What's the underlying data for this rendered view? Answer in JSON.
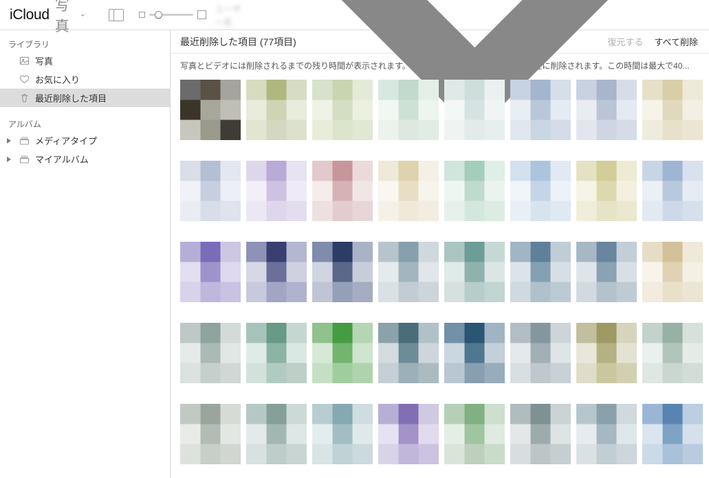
{
  "toolbar": {
    "brand": "iCloud",
    "brand_sub": "写真",
    "account_name": "ユーザー名"
  },
  "sidebar": {
    "section_library": "ライブラリ",
    "items_library": [
      {
        "label": "写真",
        "icon": "photos"
      },
      {
        "label": "お気に入り",
        "icon": "heart"
      },
      {
        "label": "最近削除した項目",
        "icon": "trash",
        "selected": true
      }
    ],
    "section_albums": "アルバム",
    "items_albums": [
      {
        "label": "メディアタイプ",
        "icon": "stack",
        "disclosure": true
      },
      {
        "label": "マイアルバム",
        "icon": "stack",
        "disclosure": true
      }
    ]
  },
  "main": {
    "title": "最近削除した項目 (77項目)",
    "btn_recover": "復元する",
    "btn_delete_all": "すべて削除",
    "info": "写真とビデオには削除されるまでの残り時間が表示されます。この時間が経過すると、項目は完全に削除されます。この時間は最大で40..."
  },
  "grid": {
    "tiles": [
      [
        "6b6b6b",
        "5a5244",
        "a5a49d",
        "3b3529",
        "a7a79b",
        "bfbfb5",
        "c7c7bd",
        "9b9a8c",
        "3e3c35"
      ],
      [
        "d8dcbf",
        "b0b87f",
        "d7dcc5",
        "e9ebdb",
        "cfd4b2",
        "e8ecdd",
        "e2e5d0",
        "d5d8c1",
        "dde1cb"
      ],
      [
        "d7e1cc",
        "c7d6b0",
        "e3ead7",
        "eff3e6",
        "d3dec2",
        "ebf0e0",
        "e8eddb",
        "dce4cb",
        "e0e7d3"
      ],
      [
        "d7e8e0",
        "c1dacd",
        "e4efe8",
        "f1f7f2",
        "cee1d5",
        "eef5ef",
        "ecf2ec",
        "dde9e0",
        "e1ece4"
      ],
      [
        "dfeae8",
        "cddedb",
        "eaf1f0",
        "f3f8f7",
        "d5e4e2",
        "f0f5f4",
        "eff3f2",
        "e2ebea",
        "e6eeee"
      ],
      [
        "c7d3e2",
        "a3b6cd",
        "d6dee9",
        "e9eef4",
        "b8c7d9",
        "e4ebf2",
        "e0e7ef",
        "cbd6e4",
        "d3dce8"
      ],
      [
        "c9d2e1",
        "a8b5cb",
        "d7dde8",
        "e9edf3",
        "bac5d6",
        "e5e9f1",
        "e2e7ef",
        "ced6e3",
        "d5dce7"
      ],
      [
        "e6e0c9",
        "d8cfa7",
        "eee9d8",
        "f6f3e9",
        "e1d9bd",
        "f3efe3",
        "f0ecdd",
        "e7e1cc",
        "ebe5d2"
      ],
      [
        "d9dee9",
        "b5bfd4",
        "e3e7ef",
        "f0f2f7",
        "c7cfdf",
        "eceff5",
        "e9ecf3",
        "d7dde9",
        "dee3ed"
      ],
      [
        "ded7ec",
        "b9aad7",
        "e8e3f2",
        "f2eff8",
        "cec2e2",
        "efebf6",
        "ece7f4",
        "ded6eb",
        "e4ddf0"
      ],
      [
        "e2c9cb",
        "c7969a",
        "ecdadb",
        "f5ecec",
        "d7b2b5",
        "f1e6e6",
        "eee0e1",
        "e3cccf",
        "e8d5d7"
      ],
      [
        "eee9d8",
        "ded2af",
        "f4f0e5",
        "faf7f0",
        "e7dec5",
        "f7f4eb",
        "f5f1e6",
        "efe9d9",
        "f2ede0"
      ],
      [
        "d0e5dc",
        "a5cdbb",
        "dfeee7",
        "eef6f2",
        "bfdbcd",
        "ebf3ee",
        "e7f1eb",
        "d4e7de",
        "dcece3"
      ],
      [
        "d3e1ee",
        "acc5dd",
        "e1eaf4",
        "f0f5fa",
        "c3d5e6",
        "edf2f8",
        "e9eff6",
        "d7e3ef",
        "dfe9f3"
      ],
      [
        "e5e2c3",
        "d3cd97",
        "eeebd5",
        "f6f4e7",
        "ded8af",
        "f3f0df",
        "f0eed8",
        "e6e3c7",
        "ebe8cf"
      ],
      [
        "c8d5e6",
        "9fb6d2",
        "d8e1ee",
        "eaf0f6",
        "b8c9dd",
        "e5ecf4",
        "e1e9f2",
        "cdd9e8",
        "d5e0ec"
      ],
      [
        "b5aed7",
        "7a6cb8",
        "cdc7e3",
        "e3dff1",
        "9f93cb",
        "ded9ee",
        "d8d2ea",
        "bfb7dc",
        "c9c2e2"
      ],
      [
        "8e92b7",
        "3a3f71",
        "b4b7d0",
        "d6d8e5",
        "6b6f99",
        "cfd1e1",
        "c7c9dc",
        "a2a5c4",
        "b0b3ce"
      ],
      [
        "7f8cab",
        "2b3c66",
        "aab2c8",
        "d0d5e1",
        "5a6789",
        "c8cdda",
        "bfc5d4",
        "949fb9",
        "a4adc2"
      ],
      [
        "b7c4cc",
        "86a0ad",
        "cfd8dd",
        "e5eaec",
        "a3b6c0",
        "e0e6e9",
        "dae1e4",
        "c1cdd3",
        "cbd5da"
      ],
      [
        "aac5c2",
        "6e9d98",
        "c6d8d6",
        "e0eae9",
        "8fb2ae",
        "dbe6e4",
        "d4e1df",
        "b6cdca",
        "c1d5d2"
      ],
      [
        "a1b6c5",
        "5f8099",
        "c0cdd7",
        "dde4e9",
        "84a0b3",
        "d7dfe5",
        "cfd9e0",
        "b0c1cc",
        "bccad4"
      ],
      [
        "a7b8c5",
        "6a85a0",
        "c3ced7",
        "dee5ea",
        "8ba2b4",
        "d8e0e6",
        "d1dae1",
        "b4c2cc",
        "bfcbd4"
      ],
      [
        "e7ddc7",
        "d3c19a",
        "f0e9da",
        "f8f4ec",
        "e0d2b3",
        "f5efe4",
        "f2ebde",
        "e9e0cc",
        "ede5d4"
      ],
      [
        "bcc9c6",
        "8ea49e",
        "d2dbd8",
        "e6ebe9",
        "aabab5",
        "e1e7e5",
        "dbe2df",
        "c5d0cc",
        "cfd8d4"
      ],
      [
        "a6c4bb",
        "689a88",
        "c4d8d1",
        "e0ebe7",
        "8cb4a5",
        "dbe7e2",
        "d3e1db",
        "b2cbc2",
        "becfc8"
      ],
      [
        "8fc28d",
        "459c42",
        "b4d6b2",
        "d6e9d5",
        "71b56f",
        "cfe5cd",
        "c6dfc4",
        "a0cd9d",
        "afd4ad"
      ],
      [
        "8ba2ab",
        "4a6c7b",
        "b1c1c8",
        "d4dce0",
        "6e8c98",
        "cdd6db",
        "c4d0d5",
        "9cb0b9",
        "abbbc2"
      ],
      [
        "7290a6",
        "2a5573",
        "a0b4c4",
        "cbd6df",
        "4f7890",
        "c3cfd9",
        "b8c7d2",
        "879fb1",
        "98adbc"
      ],
      [
        "b2bec4",
        "84979f",
        "cdd5da",
        "e4e9eb",
        "a1afb6",
        "dfe5e7",
        "d8dfe2",
        "bec8cd",
        "c8d1d5"
      ],
      [
        "c2bf9e",
        "9e9965",
        "d6d4bc",
        "e9e7da",
        "b5b183",
        "e4e2d2",
        "dfddc9",
        "cac79e",
        "d2d0b1"
      ],
      [
        "c3d2cb",
        "98b1a5",
        "d7e1dc",
        "eaf0ed",
        "b2c5bb",
        "e5ece8",
        "dfe7e2",
        "cad7d0",
        "d2ddd7"
      ],
      [
        "c2c9c3",
        "9aa69b",
        "d6dbd6",
        "e8ebe8",
        "b3bcb4",
        "e3e7e3",
        "dde2dd",
        "c8cec8",
        "d1d6d1"
      ],
      [
        "b5c8c5",
        "869f99",
        "ccd9d7",
        "e3eae9",
        "a3b7b2",
        "dee7e5",
        "d7e1df",
        "becdca",
        "c8d5d2"
      ],
      [
        "b7cdd2",
        "85a9b0",
        "cedde0",
        "e4edee",
        "a2bec4",
        "dfe9eb",
        "d8e4e6",
        "c0d2d6",
        "cbdadd"
      ],
      [
        "b7afd4",
        "826eb5",
        "cfc9e2",
        "e6e2f1",
        "a393c8",
        "e0dbee",
        "d9d3ea",
        "c0b7da",
        "cbc3e1"
      ],
      [
        "b5d0b6",
        "81b082",
        "cedfce",
        "e5eee5",
        "a0c5a1",
        "e0eae0",
        "d9e5d9",
        "becfbe",
        "c9dcc9"
      ],
      [
        "b0bcbe",
        "7e9294",
        "cbd3d5",
        "e3e7e8",
        "9cacad",
        "dee3e4",
        "d7dedf",
        "bcc6c7",
        "c6cfd0"
      ],
      [
        "b6c6cd",
        "8aa1ac",
        "cfd9de",
        "e5ebee",
        "a6b8c1",
        "e0e7ea",
        "d9e1e5",
        "c1ced4",
        "ccd6db"
      ],
      [
        "9ab6d4",
        "5884b1",
        "bbcee2",
        "dae5f0",
        "7ea3c5",
        "d4e0ec",
        "cbdae8",
        "a9c1d9",
        "b8cbdf"
      ]
    ]
  }
}
